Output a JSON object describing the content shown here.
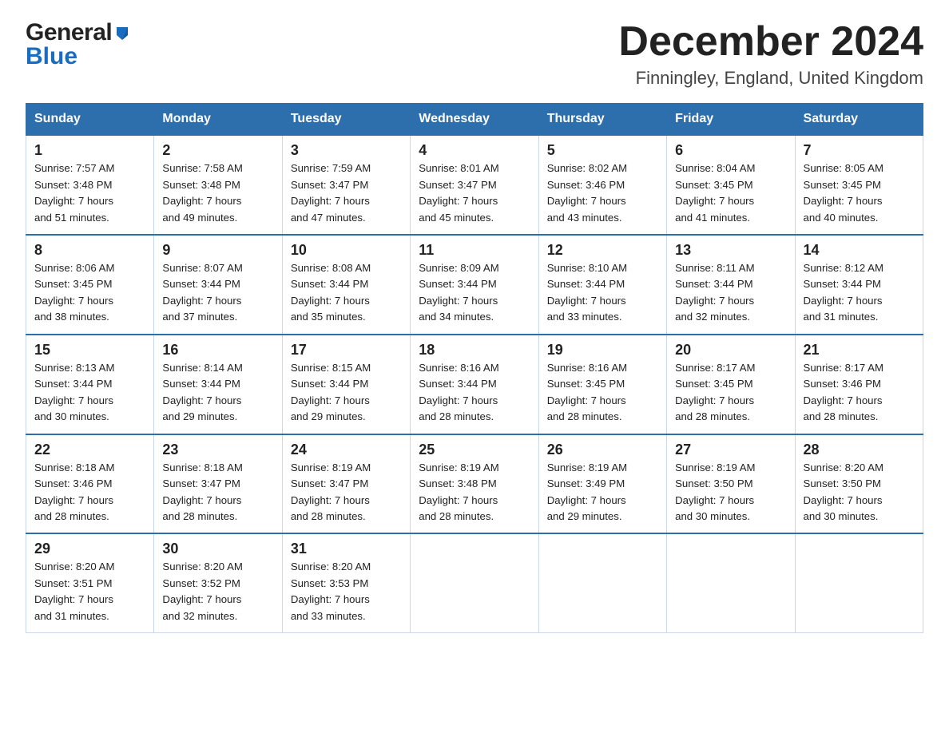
{
  "logo": {
    "general": "General",
    "blue": "Blue"
  },
  "header": {
    "title": "December 2024",
    "subtitle": "Finningley, England, United Kingdom"
  },
  "days_of_week": [
    "Sunday",
    "Monday",
    "Tuesday",
    "Wednesday",
    "Thursday",
    "Friday",
    "Saturday"
  ],
  "weeks": [
    [
      {
        "day": "1",
        "info": "Sunrise: 7:57 AM\nSunset: 3:48 PM\nDaylight: 7 hours\nand 51 minutes."
      },
      {
        "day": "2",
        "info": "Sunrise: 7:58 AM\nSunset: 3:48 PM\nDaylight: 7 hours\nand 49 minutes."
      },
      {
        "day": "3",
        "info": "Sunrise: 7:59 AM\nSunset: 3:47 PM\nDaylight: 7 hours\nand 47 minutes."
      },
      {
        "day": "4",
        "info": "Sunrise: 8:01 AM\nSunset: 3:47 PM\nDaylight: 7 hours\nand 45 minutes."
      },
      {
        "day": "5",
        "info": "Sunrise: 8:02 AM\nSunset: 3:46 PM\nDaylight: 7 hours\nand 43 minutes."
      },
      {
        "day": "6",
        "info": "Sunrise: 8:04 AM\nSunset: 3:45 PM\nDaylight: 7 hours\nand 41 minutes."
      },
      {
        "day": "7",
        "info": "Sunrise: 8:05 AM\nSunset: 3:45 PM\nDaylight: 7 hours\nand 40 minutes."
      }
    ],
    [
      {
        "day": "8",
        "info": "Sunrise: 8:06 AM\nSunset: 3:45 PM\nDaylight: 7 hours\nand 38 minutes."
      },
      {
        "day": "9",
        "info": "Sunrise: 8:07 AM\nSunset: 3:44 PM\nDaylight: 7 hours\nand 37 minutes."
      },
      {
        "day": "10",
        "info": "Sunrise: 8:08 AM\nSunset: 3:44 PM\nDaylight: 7 hours\nand 35 minutes."
      },
      {
        "day": "11",
        "info": "Sunrise: 8:09 AM\nSunset: 3:44 PM\nDaylight: 7 hours\nand 34 minutes."
      },
      {
        "day": "12",
        "info": "Sunrise: 8:10 AM\nSunset: 3:44 PM\nDaylight: 7 hours\nand 33 minutes."
      },
      {
        "day": "13",
        "info": "Sunrise: 8:11 AM\nSunset: 3:44 PM\nDaylight: 7 hours\nand 32 minutes."
      },
      {
        "day": "14",
        "info": "Sunrise: 8:12 AM\nSunset: 3:44 PM\nDaylight: 7 hours\nand 31 minutes."
      }
    ],
    [
      {
        "day": "15",
        "info": "Sunrise: 8:13 AM\nSunset: 3:44 PM\nDaylight: 7 hours\nand 30 minutes."
      },
      {
        "day": "16",
        "info": "Sunrise: 8:14 AM\nSunset: 3:44 PM\nDaylight: 7 hours\nand 29 minutes."
      },
      {
        "day": "17",
        "info": "Sunrise: 8:15 AM\nSunset: 3:44 PM\nDaylight: 7 hours\nand 29 minutes."
      },
      {
        "day": "18",
        "info": "Sunrise: 8:16 AM\nSunset: 3:44 PM\nDaylight: 7 hours\nand 28 minutes."
      },
      {
        "day": "19",
        "info": "Sunrise: 8:16 AM\nSunset: 3:45 PM\nDaylight: 7 hours\nand 28 minutes."
      },
      {
        "day": "20",
        "info": "Sunrise: 8:17 AM\nSunset: 3:45 PM\nDaylight: 7 hours\nand 28 minutes."
      },
      {
        "day": "21",
        "info": "Sunrise: 8:17 AM\nSunset: 3:46 PM\nDaylight: 7 hours\nand 28 minutes."
      }
    ],
    [
      {
        "day": "22",
        "info": "Sunrise: 8:18 AM\nSunset: 3:46 PM\nDaylight: 7 hours\nand 28 minutes."
      },
      {
        "day": "23",
        "info": "Sunrise: 8:18 AM\nSunset: 3:47 PM\nDaylight: 7 hours\nand 28 minutes."
      },
      {
        "day": "24",
        "info": "Sunrise: 8:19 AM\nSunset: 3:47 PM\nDaylight: 7 hours\nand 28 minutes."
      },
      {
        "day": "25",
        "info": "Sunrise: 8:19 AM\nSunset: 3:48 PM\nDaylight: 7 hours\nand 28 minutes."
      },
      {
        "day": "26",
        "info": "Sunrise: 8:19 AM\nSunset: 3:49 PM\nDaylight: 7 hours\nand 29 minutes."
      },
      {
        "day": "27",
        "info": "Sunrise: 8:19 AM\nSunset: 3:50 PM\nDaylight: 7 hours\nand 30 minutes."
      },
      {
        "day": "28",
        "info": "Sunrise: 8:20 AM\nSunset: 3:50 PM\nDaylight: 7 hours\nand 30 minutes."
      }
    ],
    [
      {
        "day": "29",
        "info": "Sunrise: 8:20 AM\nSunset: 3:51 PM\nDaylight: 7 hours\nand 31 minutes."
      },
      {
        "day": "30",
        "info": "Sunrise: 8:20 AM\nSunset: 3:52 PM\nDaylight: 7 hours\nand 32 minutes."
      },
      {
        "day": "31",
        "info": "Sunrise: 8:20 AM\nSunset: 3:53 PM\nDaylight: 7 hours\nand 33 minutes."
      },
      {
        "day": "",
        "info": ""
      },
      {
        "day": "",
        "info": ""
      },
      {
        "day": "",
        "info": ""
      },
      {
        "day": "",
        "info": ""
      }
    ]
  ]
}
